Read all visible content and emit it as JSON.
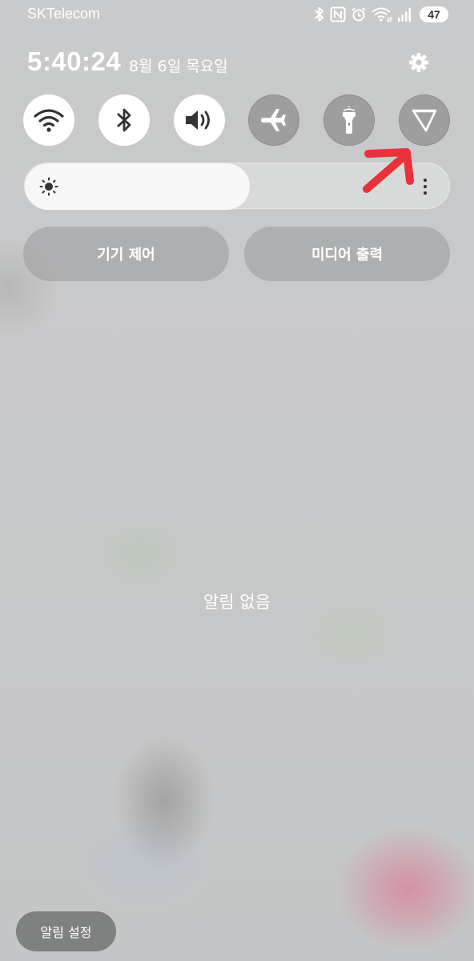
{
  "status_bar": {
    "carrier": "SKTelecom",
    "icons": [
      "bluetooth-icon",
      "nfc-icon",
      "alarm-icon",
      "wifi-icon",
      "signal-icon"
    ],
    "battery": "47"
  },
  "clock": {
    "time": "5:40:24",
    "date": "8월 6일 목요일"
  },
  "quick_toggles": [
    {
      "name": "wifi",
      "icon": "wifi-icon",
      "state": "on"
    },
    {
      "name": "bluetooth",
      "icon": "bluetooth-icon",
      "state": "on"
    },
    {
      "name": "sound",
      "icon": "speaker-icon",
      "state": "on"
    },
    {
      "name": "airplane-mode",
      "icon": "airplane-icon",
      "state": "off"
    },
    {
      "name": "flashlight",
      "icon": "flashlight-icon",
      "state": "off"
    },
    {
      "name": "power-saving",
      "icon": "triangle-icon",
      "state": "off"
    }
  ],
  "brightness": {
    "level": 0.53
  },
  "buttons": {
    "device_control": "기기 제어",
    "media_output": "미디어 출력"
  },
  "notifications": {
    "empty_text": "알림 없음",
    "settings_button": "알림 설정"
  },
  "colors": {
    "annotation_arrow": "#e8323c",
    "panel_text": "#ffffff",
    "toggle_on": "#ffffff"
  }
}
